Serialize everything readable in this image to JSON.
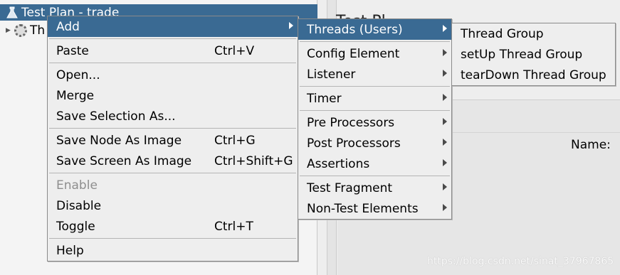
{
  "tree": {
    "selected_label": "Test Plan - trade",
    "child_label": "Th"
  },
  "right_panel": {
    "title": "Test Pl",
    "name_label": "Name:"
  },
  "watermark": "https://blog.csdn.net/sinat_37967865",
  "context_menu": {
    "items": [
      {
        "label": "Add",
        "shortcut": "",
        "submenu": true,
        "highlighted": true
      },
      {
        "label": "Paste",
        "shortcut": "Ctrl+V"
      },
      {
        "label": "Open..."
      },
      {
        "label": "Merge"
      },
      {
        "label": "Save Selection As..."
      },
      {
        "label": "Save Node As Image",
        "shortcut": "Ctrl+G"
      },
      {
        "label": "Save Screen As Image",
        "shortcut": "Ctrl+Shift+G"
      },
      {
        "label": "Enable",
        "disabled": true
      },
      {
        "label": "Disable"
      },
      {
        "label": "Toggle",
        "shortcut": "Ctrl+T"
      },
      {
        "label": "Help"
      }
    ]
  },
  "add_menu": {
    "items": [
      {
        "label": "Threads (Users)",
        "highlighted": true
      },
      {
        "label": "Config Element"
      },
      {
        "label": "Listener"
      },
      {
        "label": "Timer"
      },
      {
        "label": "Pre Processors"
      },
      {
        "label": "Post Processors"
      },
      {
        "label": "Assertions"
      },
      {
        "label": "Test Fragment"
      },
      {
        "label": "Non-Test Elements"
      }
    ]
  },
  "threads_menu": {
    "items": [
      {
        "label": "Thread Group"
      },
      {
        "label": "setUp Thread Group"
      },
      {
        "label": "tearDown Thread Group"
      }
    ]
  },
  "colors": {
    "selection": "#3a6a93",
    "menu_bg": "#eeeeee",
    "disabled_text": "#8e8e8e"
  }
}
